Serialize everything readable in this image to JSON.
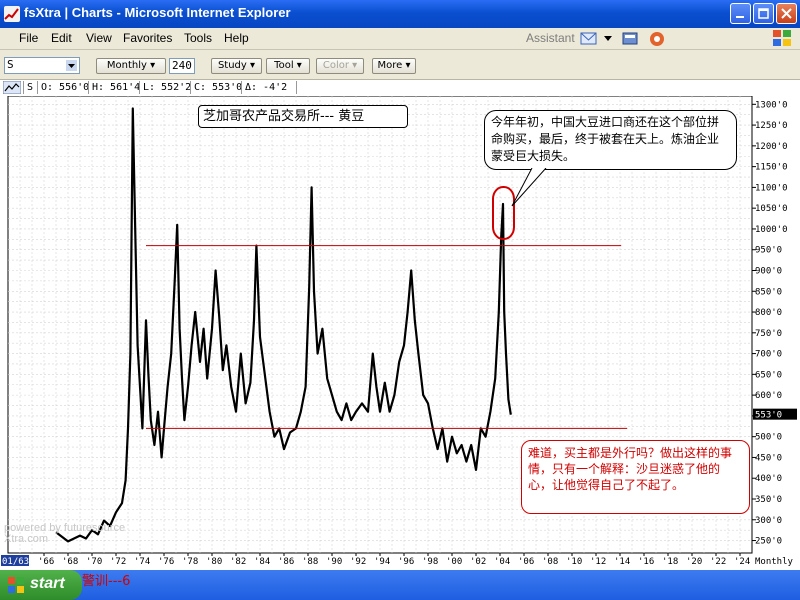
{
  "window": {
    "title": "fsXtra | Charts - Microsoft Internet Explorer"
  },
  "menu": {
    "items": [
      "File",
      "Edit",
      "View",
      "Favorites",
      "Tools",
      "Help"
    ],
    "assistant": "Assistant"
  },
  "toolbar": {
    "symbol": "S",
    "period": "Monthly",
    "count": "240",
    "buttons": [
      "Study",
      "Tool",
      "Color",
      "More"
    ]
  },
  "quote": {
    "symbol": "S",
    "open": "O: 556'0",
    "high": "H: 561'4",
    "low": "L: 552'2",
    "close": "C: 553'0",
    "change": "Δ: -4'2"
  },
  "annotations": {
    "title": "芝加哥农产品交易所--- 黄豆",
    "callout_top": "今年年初，中国大豆进口商还在这个部位拼命购买，最后，终于被套在天上。炼油企业蒙受巨大损失。",
    "callout_bottom": "难道，买主都是外行吗？做出这样的事情，只有一个解释：沙旦迷惑了他的心，让他觉得自己了不起了。",
    "watermark": "powered by futuresource Xtra.com"
  },
  "chart_data": {
    "type": "line",
    "title": "芝加哥农产品交易所--- 黄豆",
    "x_start_label": "01/63",
    "x_tick_labels": [
      "'66",
      "'68",
      "'70",
      "'72",
      "'74",
      "'76",
      "'78",
      "'80",
      "'82",
      "'84",
      "'86",
      "'88",
      "'90",
      "'92",
      "'94",
      "'96",
      "'98",
      "'00",
      "'02",
      "'04",
      "'06",
      "'08",
      "'10",
      "'12",
      "'14",
      "'16",
      "'18",
      "'20",
      "'22",
      "'24"
    ],
    "x_unit_label": "Monthly",
    "y_tick_labels": [
      "1300'0",
      "1250'0",
      "1200'0",
      "1150'0",
      "1100'0",
      "1050'0",
      "1000'0",
      "950'0",
      "900'0",
      "850'0",
      "800'0",
      "750'0",
      "700'0",
      "650'0",
      "600'0",
      "550'0",
      "500'0",
      "450'0",
      "400'0",
      "350'0",
      "300'0",
      "250'0"
    ],
    "ylim": [
      220,
      1320
    ],
    "last_price_label": "553'0",
    "series": [
      {
        "x": [
          1967.0,
          1968.0,
          1969.0,
          1969.5,
          1970.0,
          1970.5,
          1971.0,
          1971.5,
          1972.0,
          1972.5,
          1972.8,
          1973.0,
          1973.2,
          1973.4,
          1973.6,
          1973.8,
          1974.0,
          1974.2,
          1974.5,
          1974.7,
          1974.9,
          1975.2,
          1975.5,
          1975.8,
          1976.0,
          1976.3,
          1976.6,
          1976.9,
          1977.1,
          1977.3,
          1977.5,
          1977.7,
          1978.0,
          1978.3,
          1978.6,
          1979.0,
          1979.3,
          1979.6,
          1980.0,
          1980.3,
          1980.6,
          1980.9,
          1981.2,
          1981.6,
          1982.0,
          1982.4,
          1982.8,
          1983.2,
          1983.5,
          1983.7,
          1984.0,
          1984.4,
          1984.8,
          1985.2,
          1985.6,
          1986.0,
          1986.5,
          1987.0,
          1987.4,
          1987.8,
          1988.1,
          1988.3,
          1988.5,
          1988.8,
          1989.2,
          1989.6,
          1990.0,
          1990.4,
          1990.8,
          1991.2,
          1991.6,
          1992.0,
          1992.5,
          1993.0,
          1993.4,
          1993.7,
          1994.0,
          1994.4,
          1994.8,
          1995.2,
          1995.6,
          1996.0,
          1996.3,
          1996.6,
          1996.9,
          1997.2,
          1997.6,
          1998.0,
          1998.4,
          1998.8,
          1999.2,
          1999.6,
          2000.0,
          2000.4,
          2000.8,
          2001.2,
          2001.6,
          2002.0,
          2002.4,
          2002.8,
          2003.2,
          2003.6,
          2003.9,
          2004.1,
          2004.25,
          2004.35,
          2004.5,
          2004.7,
          2004.9
        ],
        "y": [
          270,
          248,
          262,
          255,
          275,
          265,
          298,
          285,
          318,
          340,
          395,
          520,
          700,
          1290,
          1000,
          720,
          620,
          520,
          780,
          650,
          540,
          480,
          560,
          450,
          520,
          620,
          700,
          880,
          1010,
          760,
          640,
          540,
          620,
          720,
          800,
          680,
          760,
          640,
          760,
          900,
          790,
          660,
          720,
          620,
          560,
          700,
          580,
          630,
          780,
          960,
          740,
          650,
          560,
          500,
          520,
          470,
          510,
          520,
          560,
          620,
          860,
          1100,
          850,
          700,
          760,
          640,
          600,
          560,
          540,
          580,
          540,
          560,
          580,
          560,
          700,
          620,
          560,
          630,
          560,
          600,
          680,
          720,
          800,
          900,
          780,
          700,
          600,
          580,
          520,
          470,
          520,
          440,
          500,
          460,
          480,
          440,
          480,
          420,
          520,
          500,
          560,
          640,
          800,
          980,
          1060,
          800,
          700,
          590,
          553
        ]
      }
    ],
    "reference_lines": [
      960,
      520
    ],
    "grid": true,
    "legend": "none"
  }
}
